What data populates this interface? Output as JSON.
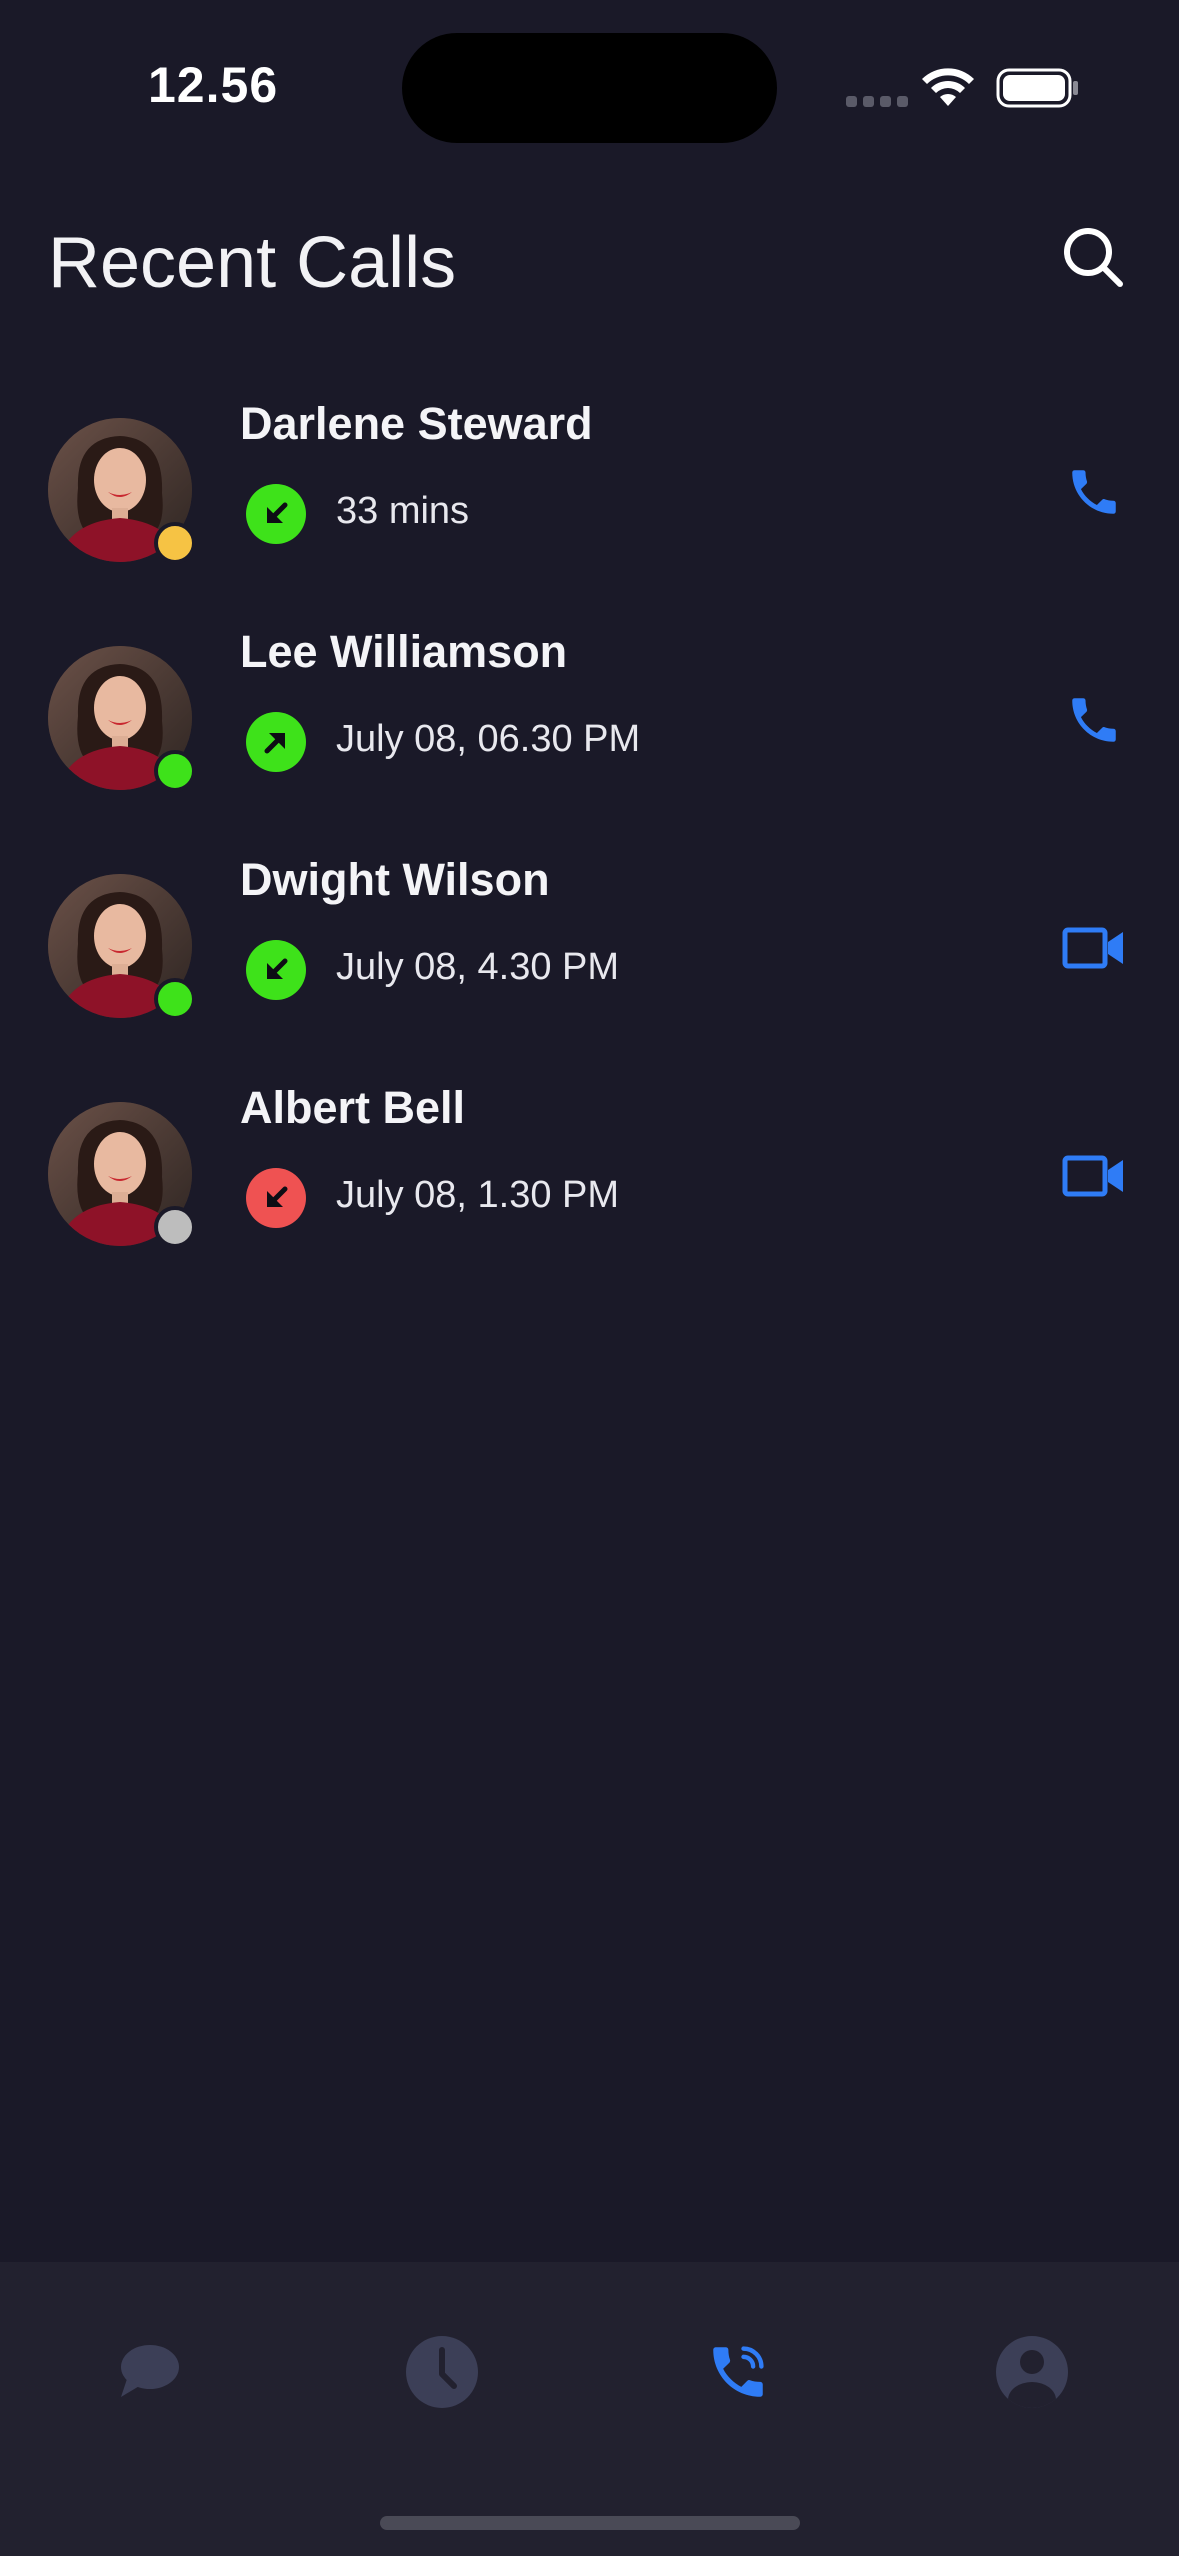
{
  "status_bar": {
    "time": "12.56"
  },
  "header": {
    "title": "Recent Calls",
    "search_icon": "search-icon"
  },
  "colors": {
    "background": "#1a1928",
    "tab_bar": "#22212f",
    "accent_blue": "#2f7cf6",
    "incoming_green": "#3ee21a",
    "missed_red": "#ef5252",
    "presence_away": "#f6c344",
    "presence_online": "#3ee21a",
    "presence_offline": "#bdbdbd",
    "tab_inactive": "#3c3f57"
  },
  "calls": [
    {
      "name": "Darlene Steward",
      "detail": "33 mins",
      "direction": "incoming",
      "presence": "away",
      "action": "voice-call"
    },
    {
      "name": "Lee Williamson",
      "detail": "July 08, 06.30 PM",
      "direction": "outgoing",
      "presence": "online",
      "action": "voice-call"
    },
    {
      "name": "Dwight Wilson",
      "detail": "July 08, 4.30 PM",
      "direction": "incoming",
      "presence": "online",
      "action": "video-call"
    },
    {
      "name": "Albert Bell",
      "detail": "July 08, 1.30 PM",
      "direction": "missed",
      "presence": "offline",
      "action": "video-call"
    }
  ],
  "tab_bar": {
    "tabs": [
      {
        "icon": "chat-bubble-icon",
        "active": false
      },
      {
        "icon": "clock-icon",
        "active": false
      },
      {
        "icon": "phone-call-icon",
        "active": true
      },
      {
        "icon": "profile-icon",
        "active": false
      }
    ]
  }
}
